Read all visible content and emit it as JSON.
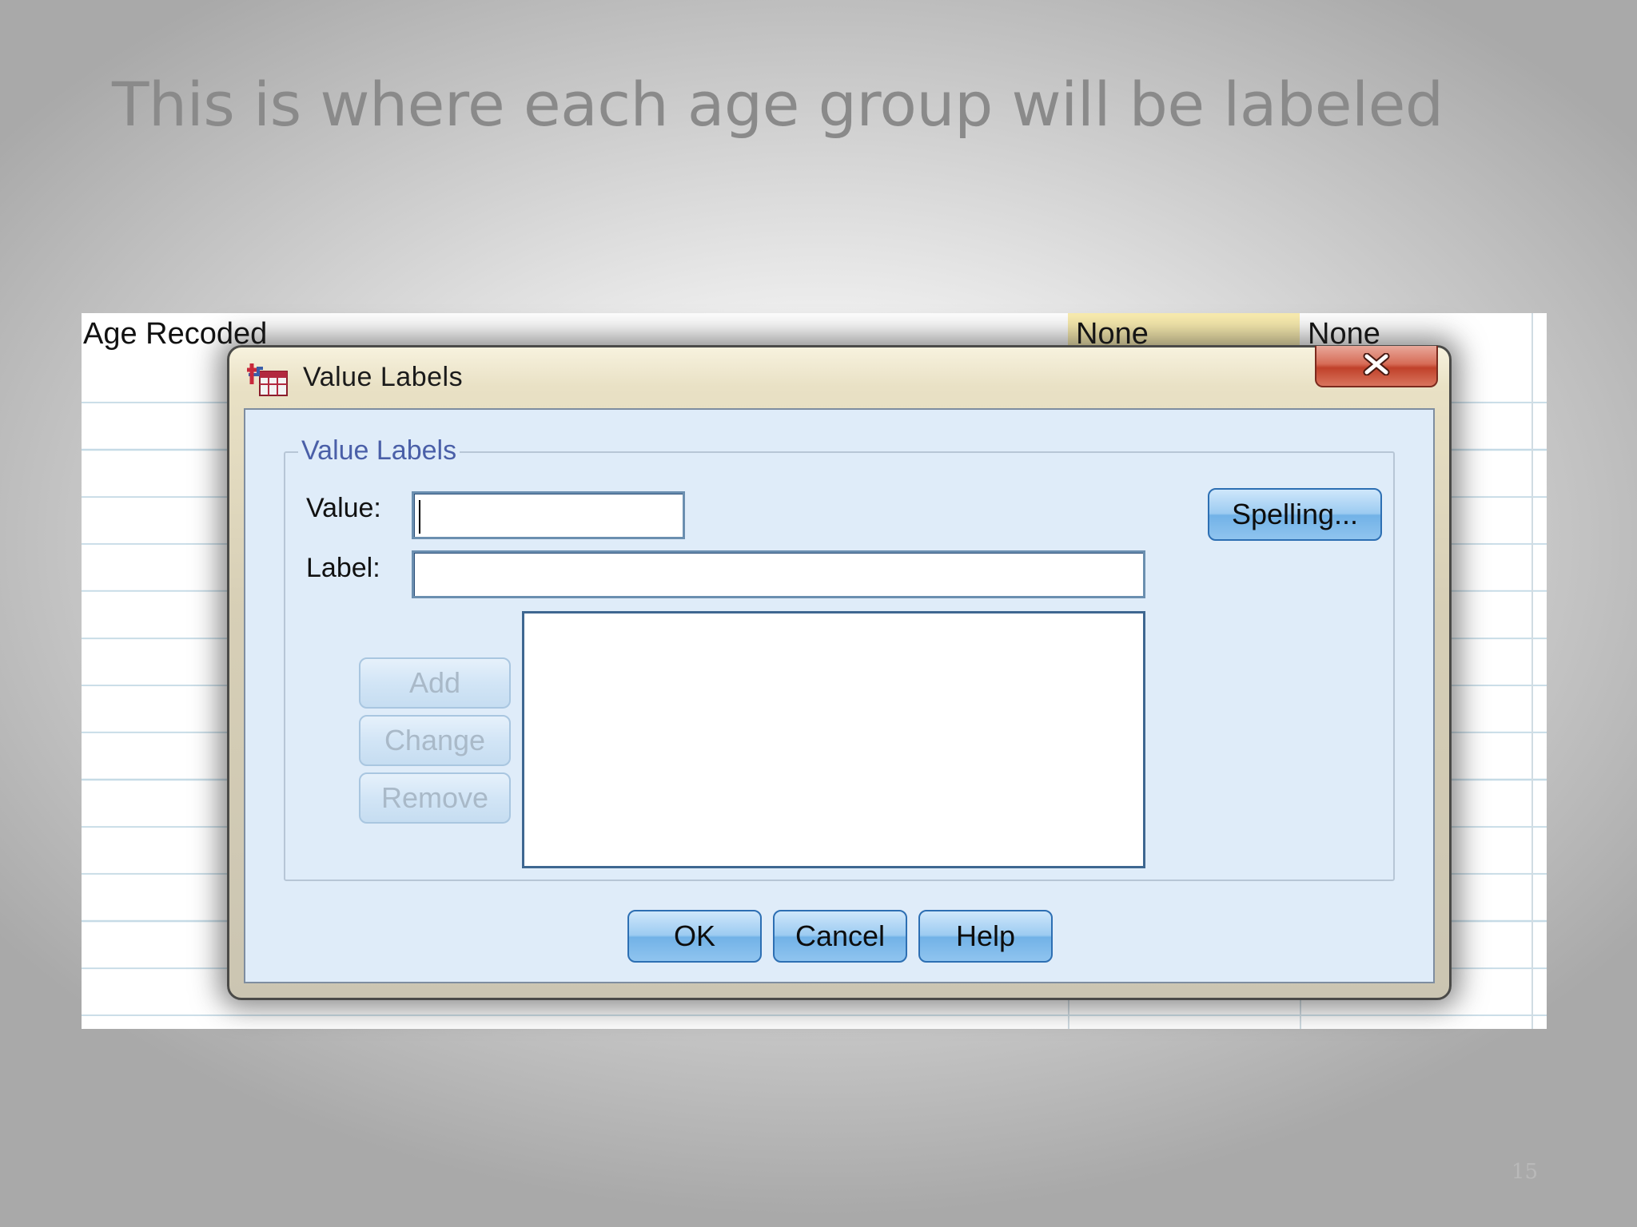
{
  "slide": {
    "title": "This is where each age group will be labeled",
    "page_number": "15"
  },
  "spreadsheet": {
    "variable_label": "Age Recoded",
    "values_cell": "None",
    "missing_cell": "None"
  },
  "dialog": {
    "title": "Value Labels",
    "close_icon": "close-icon",
    "group_legend": "Value Labels",
    "value_label": "Value:",
    "value_input": "",
    "label_label": "Label:",
    "label_input": "",
    "spelling_button": "Spelling...",
    "add_button": "Add",
    "change_button": "Change",
    "remove_button": "Remove",
    "ok_button": "OK",
    "cancel_button": "Cancel",
    "help_button": "Help"
  },
  "colors": {
    "accent_button": "#8fc4ef",
    "close_button": "#c0412a",
    "highlight_cell": "#fbeeb0"
  }
}
